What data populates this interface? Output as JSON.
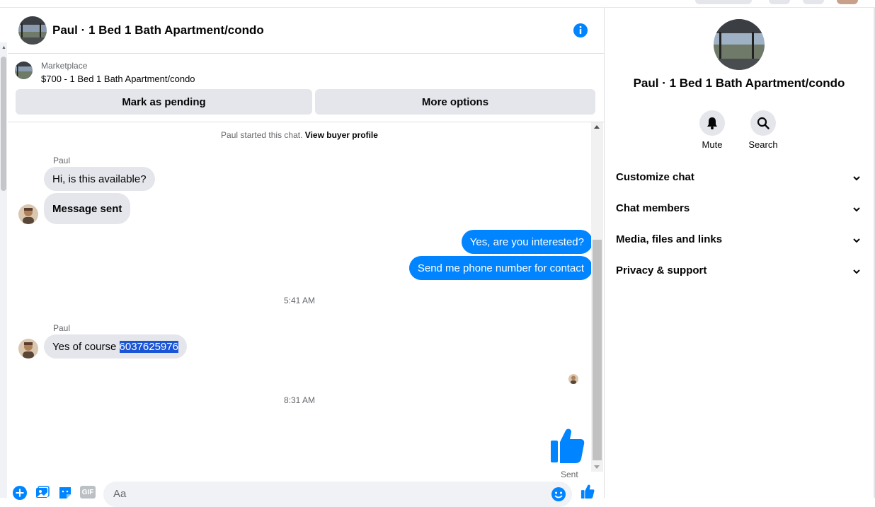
{
  "colors": {
    "accent": "#0084ff",
    "bubble_in": "#e4e6eb",
    "bubble_out": "#0084ff",
    "selection": "#1a55d6"
  },
  "header": {
    "title": "Paul · 1 Bed 1 Bath Apartment/condo",
    "info_icon": "info-icon"
  },
  "listing": {
    "label": "Marketplace",
    "price_title": "$700 - 1 Bed 1 Bath Apartment/condo",
    "buttons": {
      "mark_pending": "Mark as pending",
      "more_options": "More options"
    }
  },
  "chat": {
    "system_prefix": "Paul started this chat.",
    "system_link": "View buyer profile",
    "messages": [
      {
        "sender": "Paul",
        "text": "Hi, is this available?",
        "direction": "in"
      },
      {
        "text": "Message sent",
        "direction": "in"
      },
      {
        "text": "Yes, are you interested?",
        "direction": "out"
      },
      {
        "text": "Send me phone number for contact",
        "direction": "out"
      },
      {
        "sender": "Paul",
        "text_prefix": "Yes of course ",
        "text_selected": "6037625976",
        "direction": "in"
      }
    ],
    "timestamps": [
      "5:41 AM",
      "8:31 AM"
    ],
    "sent_status": "Sent"
  },
  "composer": {
    "placeholder": "Aa",
    "icons": [
      "plus-icon",
      "photo-icon",
      "sticker-icon",
      "gif-icon",
      "emoji-icon",
      "like-icon"
    ],
    "gif_label": "GIF"
  },
  "right_panel": {
    "title": "Paul · 1 Bed 1 Bath Apartment/condo",
    "actions": [
      {
        "label": "Mute",
        "icon": "bell-icon"
      },
      {
        "label": "Search",
        "icon": "search-icon"
      }
    ],
    "sections": [
      "Customize chat",
      "Chat members",
      "Media, files and links",
      "Privacy & support"
    ]
  }
}
